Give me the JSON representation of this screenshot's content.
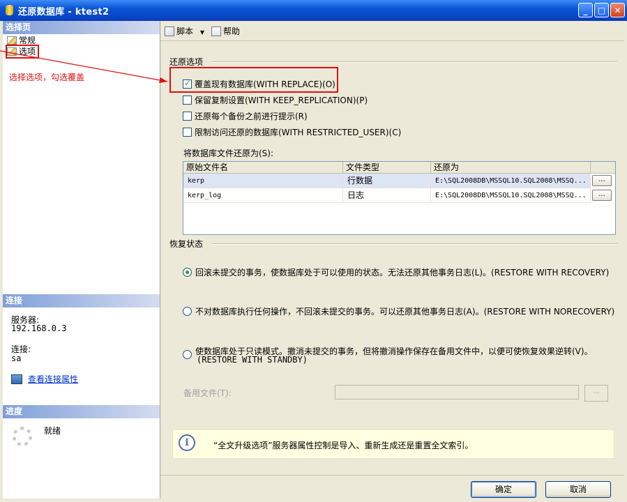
{
  "window": {
    "title": "还原数据库 - ktest2"
  },
  "left": {
    "select_page_header": "选择页",
    "pages": [
      {
        "label": "常规"
      },
      {
        "label": "选项"
      }
    ],
    "annotation": "选择选项，勾选覆盖",
    "connection_header": "连接",
    "server_label": "服务器:",
    "server_value": "192.168.0.3",
    "conn_label": "连接:",
    "conn_value": "sa",
    "view_conn_props": "查看连接属性",
    "progress_header": "进度",
    "progress_status": "就绪"
  },
  "toolbar": {
    "script_label": "脚本",
    "help_label": "帮助"
  },
  "restore_options": {
    "group_label": "还原选项",
    "options": [
      {
        "label": "覆盖现有数据库(WITH REPLACE)(O)",
        "checked": true
      },
      {
        "label": "保留复制设置(WITH KEEP_REPLICATION)(P)",
        "checked": false
      },
      {
        "label": "还原每个备份之前进行提示(R)",
        "checked": false
      },
      {
        "label": "限制访问还原的数据库(WITH RESTRICTED_USER)(C)",
        "checked": false
      }
    ],
    "files_label": "将数据库文件还原为(S):",
    "columns": [
      "原始文件名",
      "文件类型",
      "还原为"
    ],
    "rows": [
      {
        "name": "kerp",
        "type": "行数据",
        "path": "E:\\SQL2008DB\\MSSQL10.SQL2008\\MSSQ...",
        "btn": "..."
      },
      {
        "name": "kerp_log",
        "type": "日志",
        "path": "E:\\SQL2008DB\\MSSQL10.SQL2008\\MSSQ...",
        "btn": "..."
      }
    ]
  },
  "recovery": {
    "group_label": "恢复状态",
    "options": [
      {
        "label": "回滚未提交的事务，使数据库处于可以使用的状态。无法还原其他事务日志(L)。(RESTORE WITH RECOVERY)",
        "selected": true
      },
      {
        "label": "不对数据库执行任何操作，不回滚未提交的事务。可以还原其他事务日志(A)。(RESTORE WITH NORECOVERY)",
        "selected": false
      },
      {
        "label": "使数据库处于只读模式。撤消未提交的事务，但将撤消操作保存在备用文件中，以便可使恢复效果逆转(V)。",
        "label2": "(RESTORE WITH STANDBY)",
        "selected": false
      }
    ],
    "standby_label": "备用文件(T):",
    "standby_btn": "..."
  },
  "info": {
    "text": "“全文升级选项”服务器属性控制是导入、重新生成还是重置全文索引。"
  },
  "footer": {
    "ok": "确定",
    "cancel": "取消"
  }
}
